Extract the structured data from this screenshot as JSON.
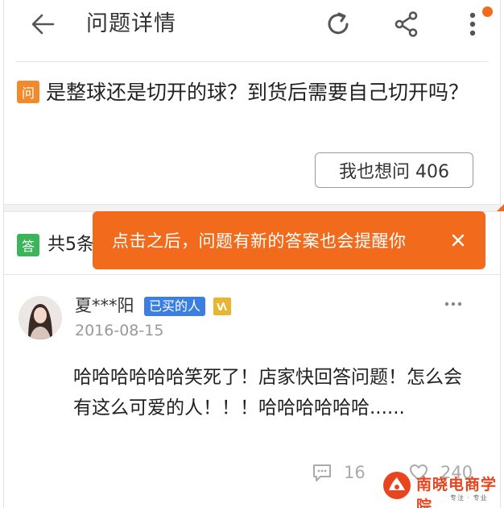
{
  "header": {
    "title": "问题详情",
    "back_icon": "arrow-left-icon",
    "refresh_icon": "refresh-icon",
    "share_icon": "share-icon",
    "more_icon": "more-vertical-icon",
    "notification_dot_color": "#f26a1b"
  },
  "question": {
    "badge": "问",
    "badge_color": "#f08a2c",
    "text": "是整球还是切开的球？到货后需要自己切开吗？",
    "ask_button_label": "我也想问 406"
  },
  "answers": {
    "badge": "答",
    "badge_color": "#3bb45a",
    "count_label": "共5条"
  },
  "tooltip": {
    "text": "点击之后，问题有新的答案也会提醒你",
    "close_label": "✕",
    "color": "#f26a1b"
  },
  "answer": {
    "user_name": "夏***阳",
    "bought_label": "已买的人",
    "bought_color": "#3b7fe0",
    "level_badge_color": "#e8b530",
    "date": "2016-08-15",
    "more_label": "•••",
    "text": "哈哈哈哈哈哈笑死了！店家快回答问题！怎么会有这么可爱的人！！！哈哈哈哈哈哈......",
    "comments_count": "16",
    "likes_count": "240"
  },
  "watermark": {
    "title": "南晓电商学院",
    "subtitle": "专注 · 专业",
    "color": "#e8441e"
  }
}
